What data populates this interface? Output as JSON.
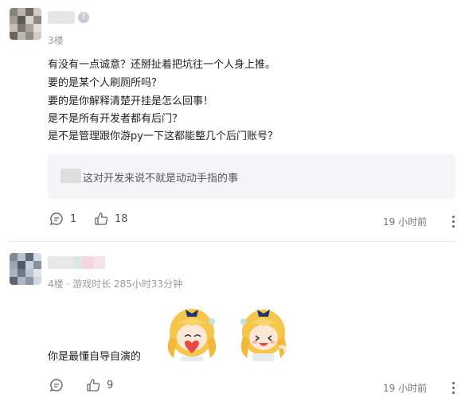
{
  "floor3": {
    "floor_label": "3楼",
    "lines": [
      "有没有一点诚意？还掰扯着把坑往一个人身上推。",
      "要的是某个人刷厕所吗？",
      "要的是你解释清楚开挂是怎么回事！",
      "是不是所有开发者都有后门？",
      "是不是管理跟你游py一下这都能整几个后门账号？"
    ],
    "quote_text": "这对开发来说不就是动动手指的事",
    "reply_count": "1",
    "like_count": "18",
    "time": "19 小时前",
    "icons": {
      "reply": "comment-icon",
      "like": "thumbs-up-icon",
      "more": "more-vertical-icon"
    }
  },
  "floor4": {
    "floor_meta": "4楼 · 游戏时长 285小时33分钟",
    "text": "你是最懂自导自演的",
    "like_count": "9",
    "time": "19 小时前",
    "stickers": [
      "anime-girl-heart-sticker",
      "anime-girl-laugh-sticker"
    ]
  },
  "colors": {
    "text": "#222222",
    "meta": "#9a9a9a",
    "quote_bg": "#f5f5f7",
    "divider": "#ececec"
  }
}
